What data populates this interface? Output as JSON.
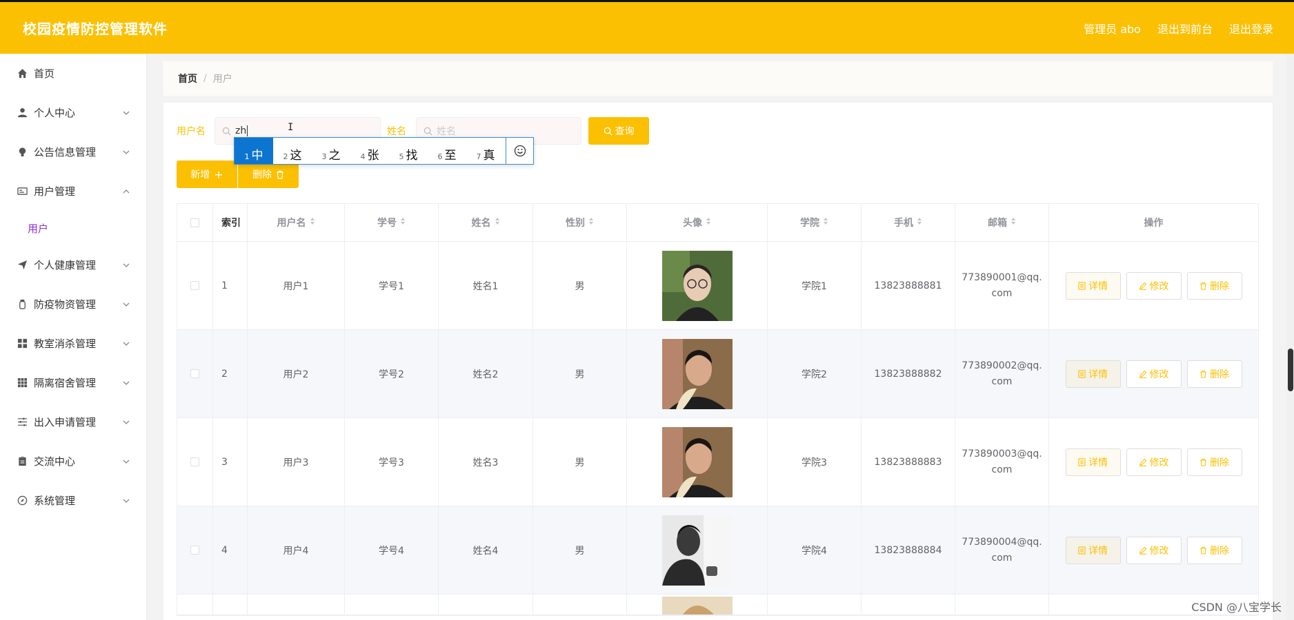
{
  "header": {
    "title": "校园疫情防控管理软件",
    "links": [
      "管理员 abo",
      "退出到前台",
      "退出登录"
    ]
  },
  "sidebar": {
    "items": [
      {
        "label": "首页",
        "icon": "home-icon",
        "expandable": false
      },
      {
        "label": "个人中心",
        "icon": "user-icon",
        "expandable": true
      },
      {
        "label": "公告信息管理",
        "icon": "bulb-icon",
        "expandable": true
      },
      {
        "label": "用户管理",
        "icon": "id-card-icon",
        "expandable": true,
        "open": true,
        "children": [
          "用户"
        ]
      },
      {
        "label": "个人健康管理",
        "icon": "send-icon",
        "expandable": true
      },
      {
        "label": "防疫物资管理",
        "icon": "bottle-icon",
        "expandable": true
      },
      {
        "label": "教室消杀管理",
        "icon": "grid-icon",
        "expandable": true
      },
      {
        "label": "隔离宿舍管理",
        "icon": "apps-icon",
        "expandable": true
      },
      {
        "label": "出入申请管理",
        "icon": "sliders-icon",
        "expandable": true
      },
      {
        "label": "交流中心",
        "icon": "clipboard-icon",
        "expandable": true
      },
      {
        "label": "系统管理",
        "icon": "compass-icon",
        "expandable": true
      }
    ]
  },
  "breadcrumb": {
    "home": "首页",
    "sep": "/",
    "current": "用户"
  },
  "search": {
    "username_label": "用户名",
    "username_value": "zh",
    "name_label": "姓名",
    "name_placeholder": "姓名",
    "query_button": "查询"
  },
  "ime": {
    "candidates": [
      {
        "n": "1",
        "c": "中"
      },
      {
        "n": "2",
        "c": "这"
      },
      {
        "n": "3",
        "c": "之"
      },
      {
        "n": "4",
        "c": "张"
      },
      {
        "n": "5",
        "c": "找"
      },
      {
        "n": "6",
        "c": "至"
      },
      {
        "n": "7",
        "c": "真"
      }
    ],
    "emoji_icon": "smiley-icon"
  },
  "actions": {
    "add": "新增",
    "delete": "删除"
  },
  "table": {
    "columns": [
      "索引",
      "用户名",
      "学号",
      "姓名",
      "性别",
      "头像",
      "学院",
      "手机",
      "邮箱",
      "操作"
    ],
    "row_actions": {
      "detail": "详情",
      "edit": "修改",
      "delete": "删除"
    },
    "rows": [
      {
        "index": "1",
        "username": "用户1",
        "student_no": "学号1",
        "name": "姓名1",
        "gender": "男",
        "college": "学院1",
        "phone": "13823888881",
        "email_1": "773890001@qq.",
        "email_2": "com"
      },
      {
        "index": "2",
        "username": "用户2",
        "student_no": "学号2",
        "name": "姓名2",
        "gender": "男",
        "college": "学院2",
        "phone": "13823888882",
        "email_1": "773890002@qq.",
        "email_2": "com"
      },
      {
        "index": "3",
        "username": "用户3",
        "student_no": "学号3",
        "name": "姓名3",
        "gender": "男",
        "college": "学院3",
        "phone": "13823888883",
        "email_1": "773890003@qq.",
        "email_2": "com"
      },
      {
        "index": "4",
        "username": "用户4",
        "student_no": "学号4",
        "name": "姓名4",
        "gender": "男",
        "college": "学院4",
        "phone": "13823888884",
        "email_1": "773890004@qq.",
        "email_2": "com"
      }
    ]
  },
  "watermark": "CSDN @八宝学长",
  "colors": {
    "accent": "#fcc003",
    "submenu_active": "#8b2fd9",
    "ime_selected": "#0d74d0"
  }
}
